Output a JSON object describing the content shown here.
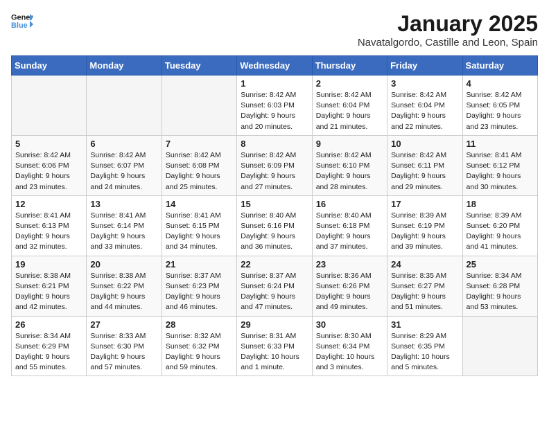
{
  "header": {
    "logo_line1": "General",
    "logo_line2": "Blue",
    "month": "January 2025",
    "location": "Navatalgordo, Castille and Leon, Spain"
  },
  "weekdays": [
    "Sunday",
    "Monday",
    "Tuesday",
    "Wednesday",
    "Thursday",
    "Friday",
    "Saturday"
  ],
  "weeks": [
    [
      {
        "day": "",
        "info": ""
      },
      {
        "day": "",
        "info": ""
      },
      {
        "day": "",
        "info": ""
      },
      {
        "day": "1",
        "info": "Sunrise: 8:42 AM\nSunset: 6:03 PM\nDaylight: 9 hours\nand 20 minutes."
      },
      {
        "day": "2",
        "info": "Sunrise: 8:42 AM\nSunset: 6:04 PM\nDaylight: 9 hours\nand 21 minutes."
      },
      {
        "day": "3",
        "info": "Sunrise: 8:42 AM\nSunset: 6:04 PM\nDaylight: 9 hours\nand 22 minutes."
      },
      {
        "day": "4",
        "info": "Sunrise: 8:42 AM\nSunset: 6:05 PM\nDaylight: 9 hours\nand 23 minutes."
      }
    ],
    [
      {
        "day": "5",
        "info": "Sunrise: 8:42 AM\nSunset: 6:06 PM\nDaylight: 9 hours\nand 23 minutes."
      },
      {
        "day": "6",
        "info": "Sunrise: 8:42 AM\nSunset: 6:07 PM\nDaylight: 9 hours\nand 24 minutes."
      },
      {
        "day": "7",
        "info": "Sunrise: 8:42 AM\nSunset: 6:08 PM\nDaylight: 9 hours\nand 25 minutes."
      },
      {
        "day": "8",
        "info": "Sunrise: 8:42 AM\nSunset: 6:09 PM\nDaylight: 9 hours\nand 27 minutes."
      },
      {
        "day": "9",
        "info": "Sunrise: 8:42 AM\nSunset: 6:10 PM\nDaylight: 9 hours\nand 28 minutes."
      },
      {
        "day": "10",
        "info": "Sunrise: 8:42 AM\nSunset: 6:11 PM\nDaylight: 9 hours\nand 29 minutes."
      },
      {
        "day": "11",
        "info": "Sunrise: 8:41 AM\nSunset: 6:12 PM\nDaylight: 9 hours\nand 30 minutes."
      }
    ],
    [
      {
        "day": "12",
        "info": "Sunrise: 8:41 AM\nSunset: 6:13 PM\nDaylight: 9 hours\nand 32 minutes."
      },
      {
        "day": "13",
        "info": "Sunrise: 8:41 AM\nSunset: 6:14 PM\nDaylight: 9 hours\nand 33 minutes."
      },
      {
        "day": "14",
        "info": "Sunrise: 8:41 AM\nSunset: 6:15 PM\nDaylight: 9 hours\nand 34 minutes."
      },
      {
        "day": "15",
        "info": "Sunrise: 8:40 AM\nSunset: 6:16 PM\nDaylight: 9 hours\nand 36 minutes."
      },
      {
        "day": "16",
        "info": "Sunrise: 8:40 AM\nSunset: 6:18 PM\nDaylight: 9 hours\nand 37 minutes."
      },
      {
        "day": "17",
        "info": "Sunrise: 8:39 AM\nSunset: 6:19 PM\nDaylight: 9 hours\nand 39 minutes."
      },
      {
        "day": "18",
        "info": "Sunrise: 8:39 AM\nSunset: 6:20 PM\nDaylight: 9 hours\nand 41 minutes."
      }
    ],
    [
      {
        "day": "19",
        "info": "Sunrise: 8:38 AM\nSunset: 6:21 PM\nDaylight: 9 hours\nand 42 minutes."
      },
      {
        "day": "20",
        "info": "Sunrise: 8:38 AM\nSunset: 6:22 PM\nDaylight: 9 hours\nand 44 minutes."
      },
      {
        "day": "21",
        "info": "Sunrise: 8:37 AM\nSunset: 6:23 PM\nDaylight: 9 hours\nand 46 minutes."
      },
      {
        "day": "22",
        "info": "Sunrise: 8:37 AM\nSunset: 6:24 PM\nDaylight: 9 hours\nand 47 minutes."
      },
      {
        "day": "23",
        "info": "Sunrise: 8:36 AM\nSunset: 6:26 PM\nDaylight: 9 hours\nand 49 minutes."
      },
      {
        "day": "24",
        "info": "Sunrise: 8:35 AM\nSunset: 6:27 PM\nDaylight: 9 hours\nand 51 minutes."
      },
      {
        "day": "25",
        "info": "Sunrise: 8:34 AM\nSunset: 6:28 PM\nDaylight: 9 hours\nand 53 minutes."
      }
    ],
    [
      {
        "day": "26",
        "info": "Sunrise: 8:34 AM\nSunset: 6:29 PM\nDaylight: 9 hours\nand 55 minutes."
      },
      {
        "day": "27",
        "info": "Sunrise: 8:33 AM\nSunset: 6:30 PM\nDaylight: 9 hours\nand 57 minutes."
      },
      {
        "day": "28",
        "info": "Sunrise: 8:32 AM\nSunset: 6:32 PM\nDaylight: 9 hours\nand 59 minutes."
      },
      {
        "day": "29",
        "info": "Sunrise: 8:31 AM\nSunset: 6:33 PM\nDaylight: 10 hours\nand 1 minute."
      },
      {
        "day": "30",
        "info": "Sunrise: 8:30 AM\nSunset: 6:34 PM\nDaylight: 10 hours\nand 3 minutes."
      },
      {
        "day": "31",
        "info": "Sunrise: 8:29 AM\nSunset: 6:35 PM\nDaylight: 10 hours\nand 5 minutes."
      },
      {
        "day": "",
        "info": ""
      }
    ]
  ]
}
